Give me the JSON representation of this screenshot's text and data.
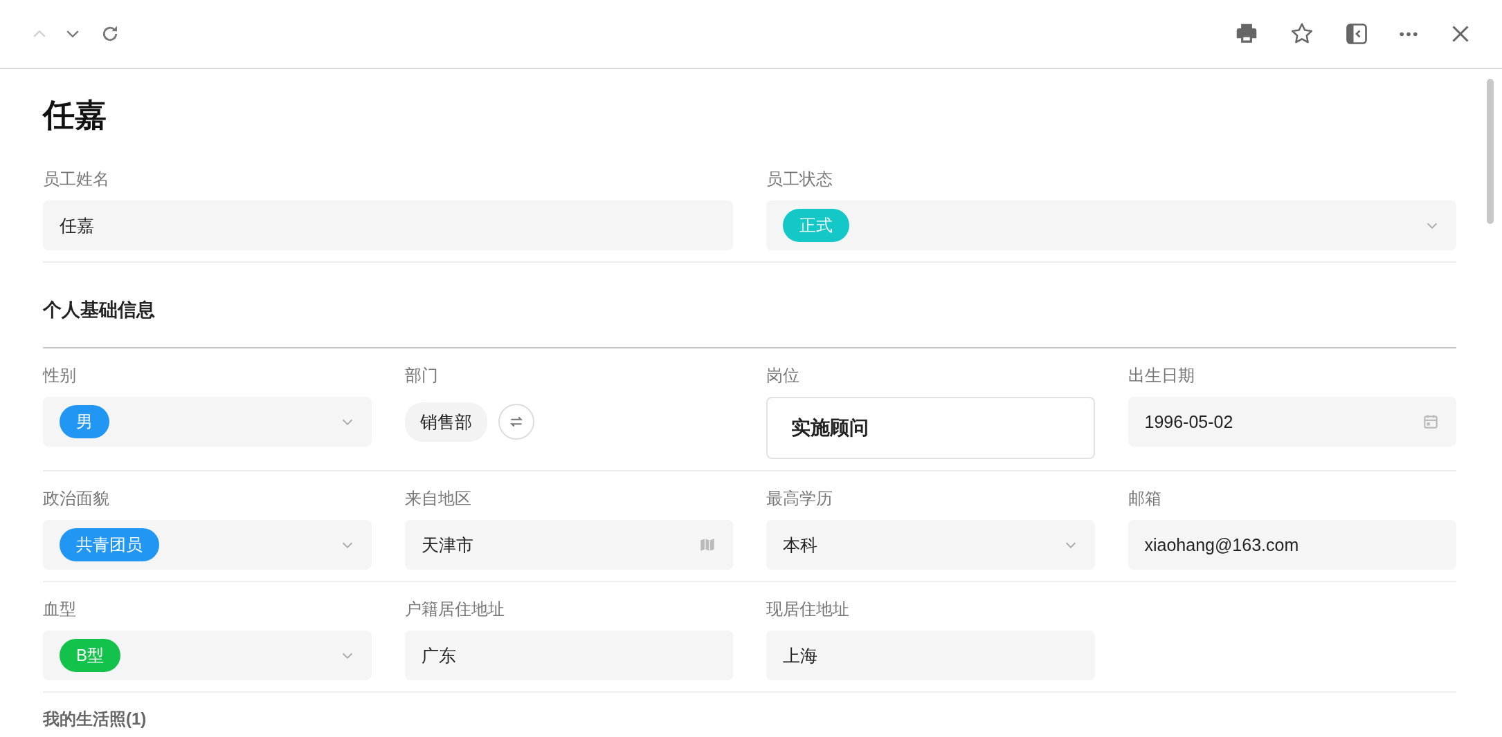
{
  "toolbar": {
    "nav": [
      {
        "kind": "up",
        "disabled": true
      },
      {
        "kind": "down",
        "disabled": false
      },
      {
        "kind": "refresh",
        "disabled": false
      }
    ],
    "actions": [
      {
        "kind": "print"
      },
      {
        "kind": "star"
      },
      {
        "kind": "panel"
      },
      {
        "kind": "more"
      },
      {
        "kind": "close"
      }
    ]
  },
  "title": "任嘉",
  "top_fields": [
    {
      "label": "员工姓名",
      "kind": "text",
      "value": "任嘉"
    },
    {
      "label": "员工状态",
      "kind": "select",
      "tag": "正式",
      "color": "#14c8c8"
    }
  ],
  "section_title": "个人基础信息",
  "rows": [
    [
      {
        "label": "性别",
        "kind": "select",
        "tag": "男",
        "color": "#2196f3"
      },
      {
        "label": "部门",
        "kind": "chip",
        "value": "销售部"
      },
      {
        "label": "岗位",
        "kind": "emphasis",
        "value": "实施顾问"
      },
      {
        "label": "出生日期",
        "kind": "date",
        "value": "1996-05-02"
      }
    ],
    [
      {
        "label": "政治面貌",
        "kind": "select",
        "tag": "共青团员",
        "color": "#2196f3"
      },
      {
        "label": "来自地区",
        "kind": "map",
        "value": "天津市"
      },
      {
        "label": "最高学历",
        "kind": "dropdown",
        "value": "本科"
      },
      {
        "label": "邮箱",
        "kind": "text",
        "value": "xiaohang@163.com"
      }
    ],
    [
      {
        "label": "血型",
        "kind": "select",
        "tag": "B型",
        "color": "#12c24a"
      },
      {
        "label": "户籍居住地址",
        "kind": "text",
        "value": "广东"
      },
      {
        "label": "现居住地址",
        "kind": "text",
        "value": "上海"
      }
    ]
  ],
  "photos_label": "我的生活照(1)"
}
